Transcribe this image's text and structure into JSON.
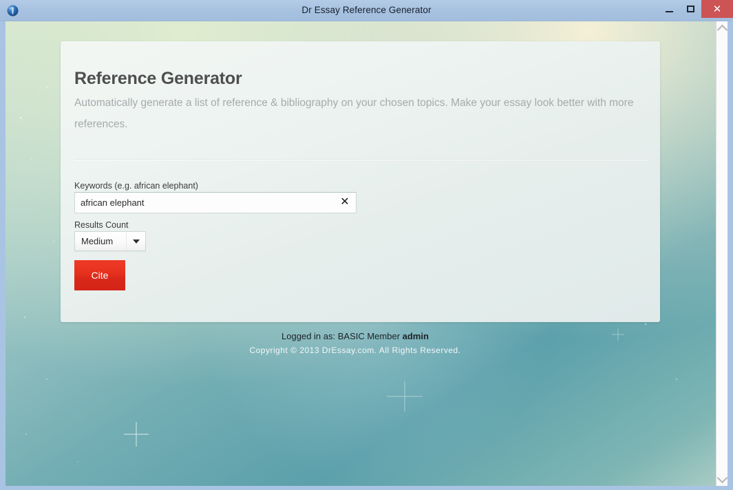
{
  "window": {
    "title": "Dr Essay Reference Generator",
    "app_icon": "globe-icon",
    "minimize_label": "",
    "maximize_label": "",
    "close_label": "✕",
    "titlebar_color": "#a7c1e0",
    "close_color": "#cc5454"
  },
  "card": {
    "title": "Reference Generator",
    "subtitle": "Automatically generate a list of reference & bibliography on your chosen topics. Make your essay look better with more references."
  },
  "form": {
    "keywords": {
      "label": "Keywords (e.g. african elephant)",
      "value": "african elephant",
      "placeholder": "african elephant",
      "clear_icon": "✕"
    },
    "results_count": {
      "label": "Results Count",
      "value": "Medium",
      "options": [
        "Medium"
      ],
      "arrow_icon": "chevron-down-icon"
    },
    "submit": {
      "label": "Cite",
      "color": "#e0291a"
    }
  },
  "footer": {
    "login_prefix": "Logged in as: BASIC Member ",
    "login_user": "admin",
    "copyright": "Copyright © 2013 DrEssay.com. All Rights Reserved."
  },
  "scrollbar": {
    "up_icon": "chevron-up-icon",
    "down_icon": "chevron-down-icon"
  }
}
